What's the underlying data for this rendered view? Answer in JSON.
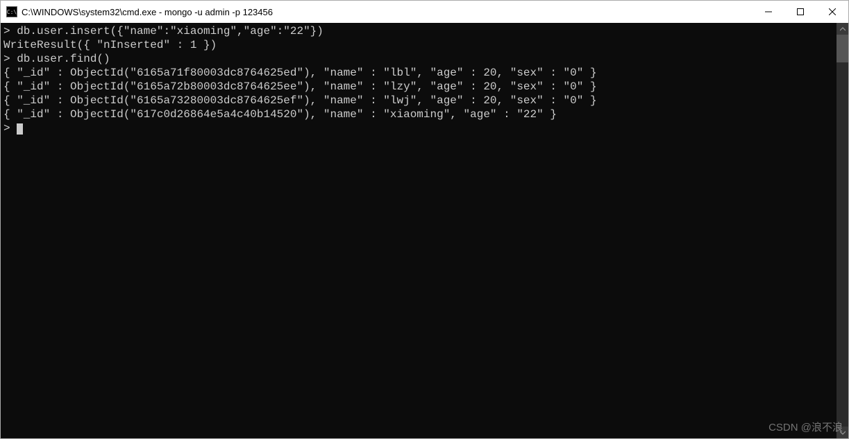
{
  "titlebar": {
    "icon_label": "C:\\",
    "title": "C:\\WINDOWS\\system32\\cmd.exe - mongo  -u admin -p 123456"
  },
  "terminal": {
    "lines": [
      "> db.user.insert({\"name\":\"xiaoming\",\"age\":\"22\"})",
      "WriteResult({ \"nInserted\" : 1 })",
      "> db.user.find()",
      "{ \"_id\" : ObjectId(\"6165a71f80003dc8764625ed\"), \"name\" : \"lbl\", \"age\" : 20, \"sex\" : \"0\" }",
      "{ \"_id\" : ObjectId(\"6165a72b80003dc8764625ee\"), \"name\" : \"lzy\", \"age\" : 20, \"sex\" : \"0\" }",
      "{ \"_id\" : ObjectId(\"6165a73280003dc8764625ef\"), \"name\" : \"lwj\", \"age\" : 20, \"sex\" : \"0\" }",
      "{ \"_id\" : ObjectId(\"617c0d26864e5a4c40b14520\"), \"name\" : \"xiaoming\", \"age\" : \"22\" }",
      "> "
    ]
  },
  "watermark": "CSDN @浪不浪"
}
